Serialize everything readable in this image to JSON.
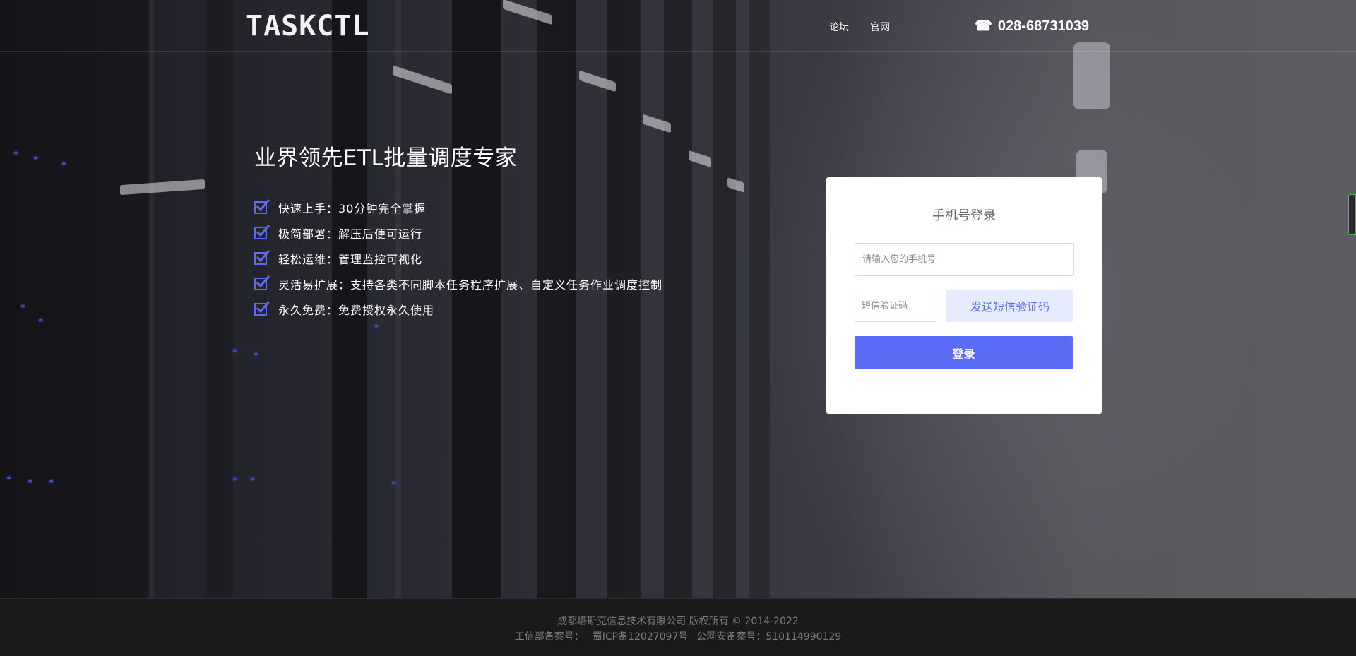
{
  "header": {
    "logo": "TASKCTL",
    "nav": [
      {
        "label": "论坛"
      },
      {
        "label": "官网"
      }
    ],
    "phone_icon": "phone-icon",
    "phone_number": "028-68731039"
  },
  "promo": {
    "title": "业界领先ETL批量调度专家",
    "features": [
      {
        "label": "快速上手",
        "desc": "30分钟完全掌握"
      },
      {
        "label": "极简部署",
        "desc": "解压后便可运行"
      },
      {
        "label": "轻松运维",
        "desc": "管理监控可视化"
      },
      {
        "label": "灵活易扩展",
        "desc": "支持各类不同脚本任务程序扩展、自定义任务作业调度控制"
      },
      {
        "label": "永久免费",
        "desc": "免费授权永久使用"
      }
    ],
    "check_color": "#5b6cf2"
  },
  "login": {
    "title": "手机号登录",
    "phone_placeholder": "请输入您的手机号",
    "phone_value": "",
    "code_placeholder": "短信验证码",
    "code_value": "",
    "send_code_label": "发送短信验证码",
    "submit_label": "登录",
    "accent_color": "#5b6cf7"
  },
  "footer": {
    "copyright": "成都塔斯克信息技术有限公司 版权所有 © 2014-2022",
    "icp_label": "工信部备案号：",
    "icp_number": "蜀ICP备12027097号",
    "police_label": "公网安备案号：510114990129"
  }
}
